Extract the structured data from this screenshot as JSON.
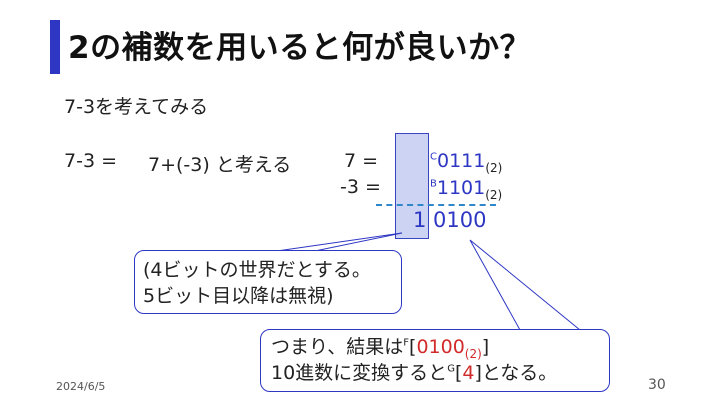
{
  "slide": {
    "title": "2の補数を用いると何が良いか？",
    "intro": "7-3を考えてみる",
    "equation_left": "7-3 =",
    "equation_mid": "7+(-3) と考える",
    "row1_label": "7 =",
    "row1_marker": "C",
    "row1_value": "0111",
    "row1_sub": "(2)",
    "row2_label": "-3 =",
    "row2_marker": "B",
    "row2_value": "1101",
    "row2_sub": "(2)",
    "result_carry": "1",
    "result_value": "0100",
    "callout1_line1": "(4ビットの世界だとする。",
    "callout1_line2": "5ビット目以降は無視)",
    "callout2_text1": "つまり、結果は",
    "callout2_marker1": "F",
    "callout2_bracket_open": "[",
    "callout2_value": "0100",
    "callout2_value_sub": "(2)",
    "callout2_bracket_close": "]",
    "callout2_line2_text": "10進数に変換すると",
    "callout2_marker2": "G",
    "callout2_bracket2_open": "[",
    "callout2_value2": "4",
    "callout2_bracket2_close": "]となる。",
    "footer_date": "2024/6/5",
    "page_number": "30"
  },
  "colors": {
    "accent": "#2e37c4",
    "highlight": "#cdd3f2",
    "red": "#d22b2b",
    "dashed_line": "#2f86c8"
  }
}
